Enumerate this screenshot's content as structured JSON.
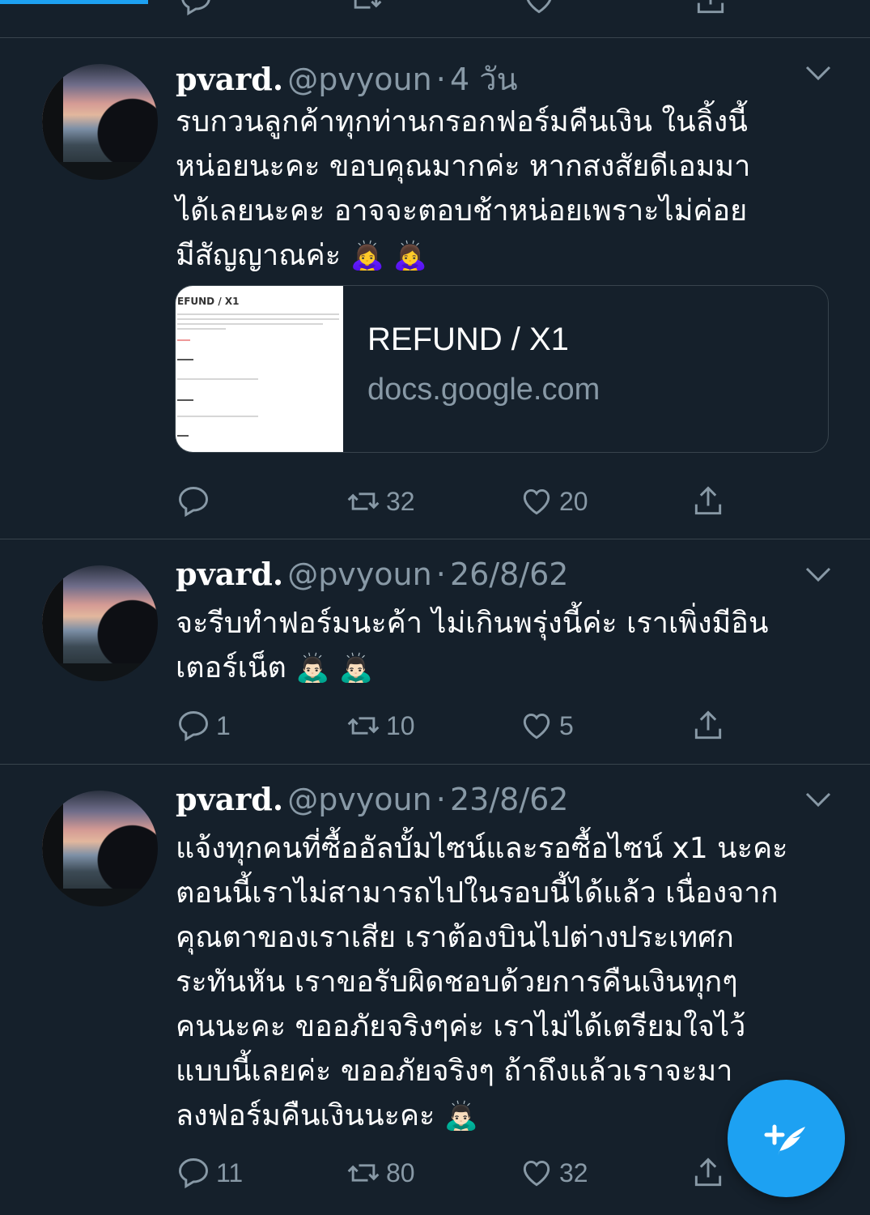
{
  "progress": {
    "percent": 17
  },
  "tweets": [
    {
      "name": "pvard.",
      "handle": "@pvyoun",
      "separator": "·",
      "time": "4 วัน",
      "lines": [
        "รบกวนลูกค้าทุกท่านกรอกฟอร์มคืนเงิน ในลิ้งนี้",
        "หน่อยนะคะ ขอบคุณมากค่ะ หากสงสัยดีเอมมา",
        "ได้เลยนะคะ อาจจะตอบช้าหน่อยเพราะไม่ค่อย",
        "มีสัญญาณค่ะ"
      ],
      "emoji": "🙇‍♀️ 🙇‍♀️",
      "card": {
        "title": "REFUND / X1",
        "domain": "docs.google.com",
        "thumb_title": "EFUND / X1"
      },
      "replies": "",
      "retweets": "32",
      "likes": "20"
    },
    {
      "name": "pvard.",
      "handle": "@pvyoun",
      "separator": "·",
      "time": "26/8/62",
      "lines": [
        "จะรีบทำฟอร์มนะค้า ไม่เกินพรุ่งนี้ค่ะ เราเพิ่งมีอิน",
        "เตอร์เน็ต"
      ],
      "emoji": "🙇🏻‍♂️ 🙇🏻‍♂️",
      "replies": "1",
      "retweets": "10",
      "likes": "5"
    },
    {
      "name": "pvard.",
      "handle": "@pvyoun",
      "separator": "·",
      "time": "23/8/62",
      "lines": [
        "แจ้งทุกคนที่ซื้ออัลบั้มไซน์และรอซื้อไซน์ x1 นะคะ",
        "ตอนนี้เราไม่สามารถไปในรอบนี้ได้แล้ว เนื่องจาก",
        "คุณตาของเราเสีย เราต้องบินไปต่างประเทศก",
        "ระทันหัน เราขอรับผิดชอบด้วยการคืนเงินทุกๆ",
        "คนนะคะ ขออภัยจริงๆค่ะ เราไม่ได้เตรียมใจไว้",
        "แบบนี้เลยค่ะ ขออภัยจริงๆ ถ้าถึงแล้วเราจะมา",
        "ลงฟอร์มคืนเงินนะคะ"
      ],
      "emoji": "🙇🏻‍♂️",
      "replies": "11",
      "retweets": "80",
      "likes": "32"
    }
  ],
  "icons": {
    "reply": "reply-icon",
    "retweet": "retweet-icon",
    "like": "heart-icon",
    "share": "share-icon",
    "compose": "compose-tweet-icon"
  },
  "colors": {
    "background": "#15202b",
    "divider": "#38444d",
    "muted": "#8899a6",
    "accent": "#1da1f2"
  }
}
